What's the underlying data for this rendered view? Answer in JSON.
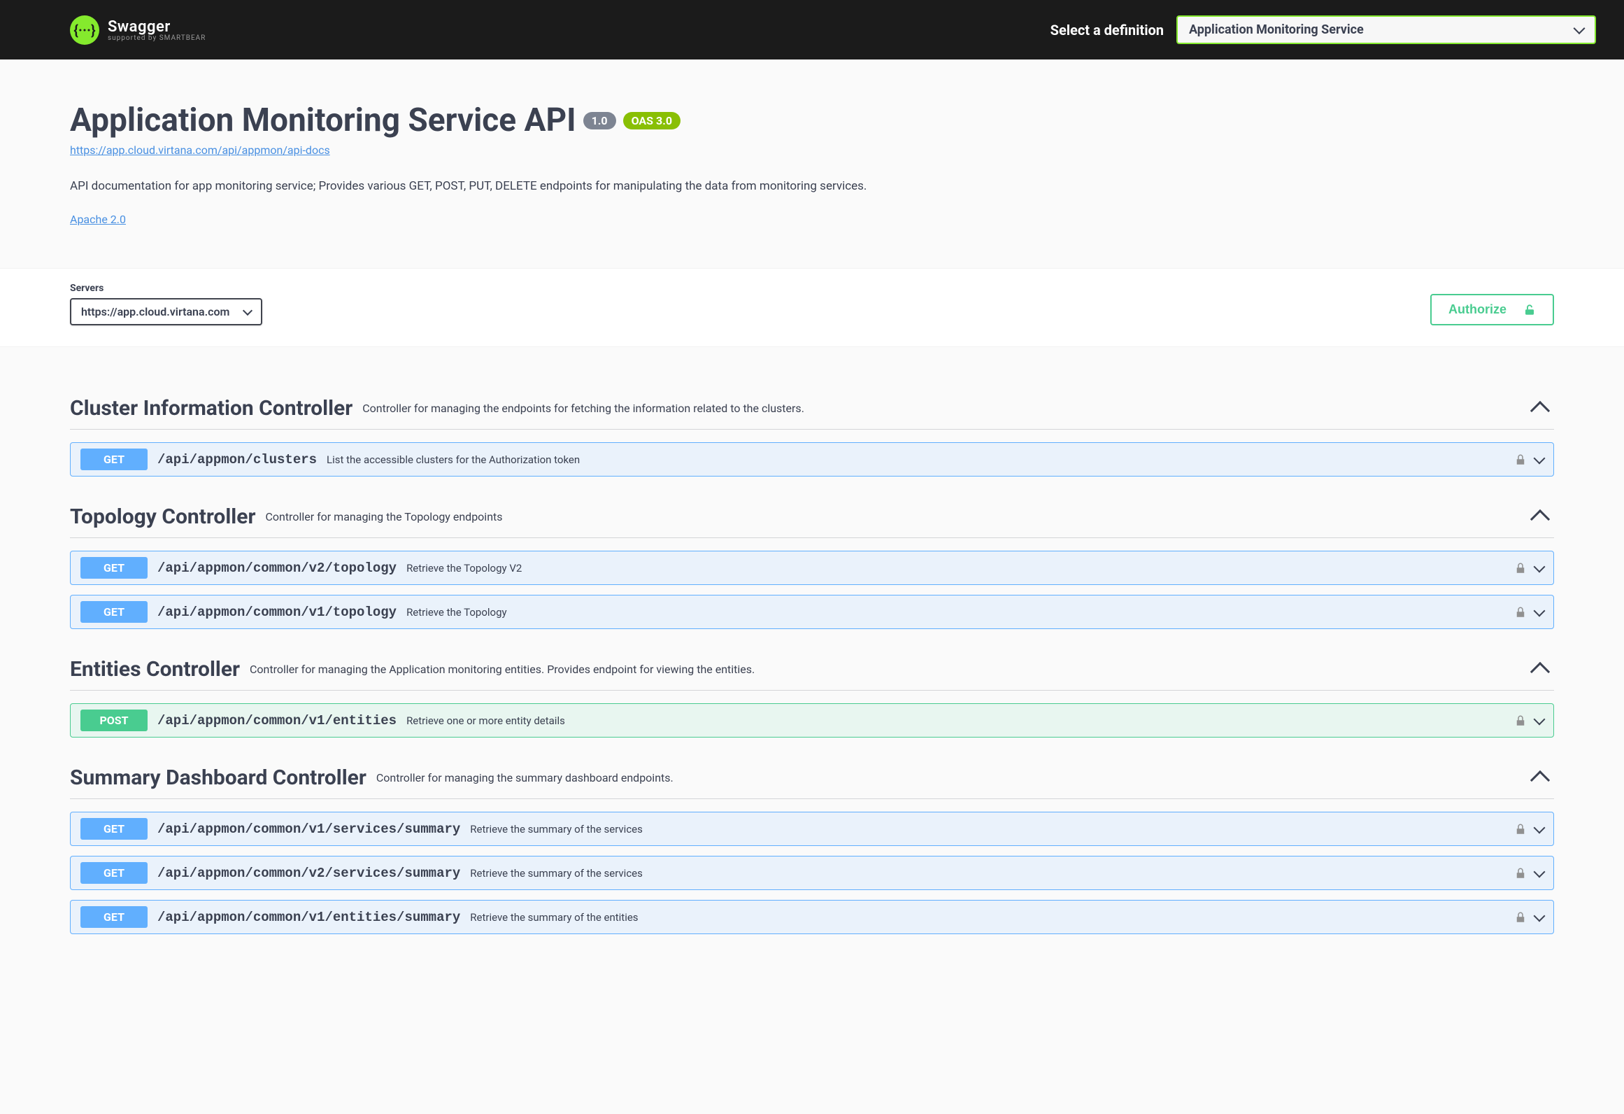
{
  "brand": {
    "name": "Swagger",
    "supported": "supported by SMARTBEAR"
  },
  "definition": {
    "label": "Select a definition",
    "selected": "Application Monitoring Service"
  },
  "api": {
    "title": "Application Monitoring Service API",
    "version": "1.0",
    "oas": "OAS 3.0",
    "url": "https://app.cloud.virtana.com/api/appmon/api-docs",
    "description": "API documentation for app monitoring service; Provides various GET, POST, PUT, DELETE endpoints for manipulating the data from monitoring services.",
    "license": "Apache 2.0"
  },
  "servers": {
    "label": "Servers",
    "selected": "https://app.cloud.virtana.com"
  },
  "authorize": "Authorize",
  "tags": [
    {
      "name": "Cluster Information Controller",
      "desc": "Controller for managing the endpoints for fetching the information related to the clusters.",
      "ops": [
        {
          "method": "GET",
          "path": "/api/appmon/clusters",
          "summary": "List the accessible clusters for the Authorization token"
        }
      ]
    },
    {
      "name": "Topology Controller",
      "desc": "Controller for managing the Topology endpoints",
      "ops": [
        {
          "method": "GET",
          "path": "/api/appmon/common/v2/topology",
          "summary": "Retrieve the Topology V2"
        },
        {
          "method": "GET",
          "path": "/api/appmon/common/v1/topology",
          "summary": "Retrieve the Topology"
        }
      ]
    },
    {
      "name": "Entities Controller",
      "desc": "Controller for managing the Application monitoring entities. Provides endpoint for viewing the entities.",
      "ops": [
        {
          "method": "POST",
          "path": "/api/appmon/common/v1/entities",
          "summary": "Retrieve one or more entity details"
        }
      ]
    },
    {
      "name": "Summary Dashboard Controller",
      "desc": "Controller for managing the summary dashboard endpoints.",
      "ops": [
        {
          "method": "GET",
          "path": "/api/appmon/common/v1/services/summary",
          "summary": "Retrieve the summary of the services"
        },
        {
          "method": "GET",
          "path": "/api/appmon/common/v2/services/summary",
          "summary": "Retrieve the summary of the services"
        },
        {
          "method": "GET",
          "path": "/api/appmon/common/v1/entities/summary",
          "summary": "Retrieve the summary of the entities"
        }
      ]
    }
  ]
}
